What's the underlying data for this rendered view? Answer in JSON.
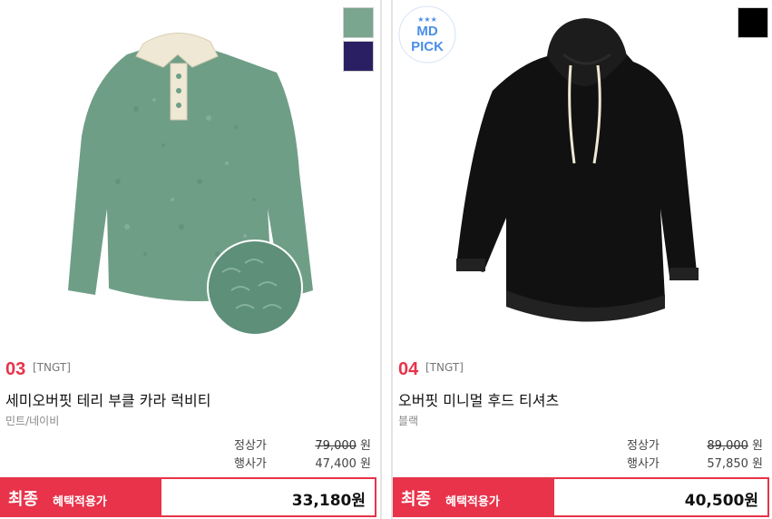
{
  "products": [
    {
      "rank": "03",
      "brand": "[TNGT]",
      "name": "세미오버핏 테리 부클 카라 럭비티",
      "color": "민트/네이비",
      "regular_price_label": "정상가",
      "regular_price": "79,000",
      "sale_price_label": "행사가",
      "sale_price": "47,400",
      "currency": "원",
      "final_label": "최종",
      "final_sub": "혜택적용가",
      "final_price": "33,180원",
      "swatches": [
        "#7aa58e",
        "#2b1f63"
      ]
    },
    {
      "rank": "04",
      "brand": "[TNGT]",
      "name": "오버핏 미니멀 후드 티셔츠",
      "color": "블랙",
      "regular_price_label": "정상가",
      "regular_price": "89,000",
      "sale_price_label": "행사가",
      "sale_price": "57,850",
      "currency": "원",
      "final_label": "최종",
      "final_sub": "혜택적용가",
      "final_price": "40,500원",
      "swatches": [
        "#000000"
      ],
      "badge": {
        "top": "★★★",
        "line1": "MD",
        "line2": "PICK"
      }
    }
  ],
  "colors": {
    "accent": "#e8334a",
    "badge_blue": "#4a8ee8"
  }
}
